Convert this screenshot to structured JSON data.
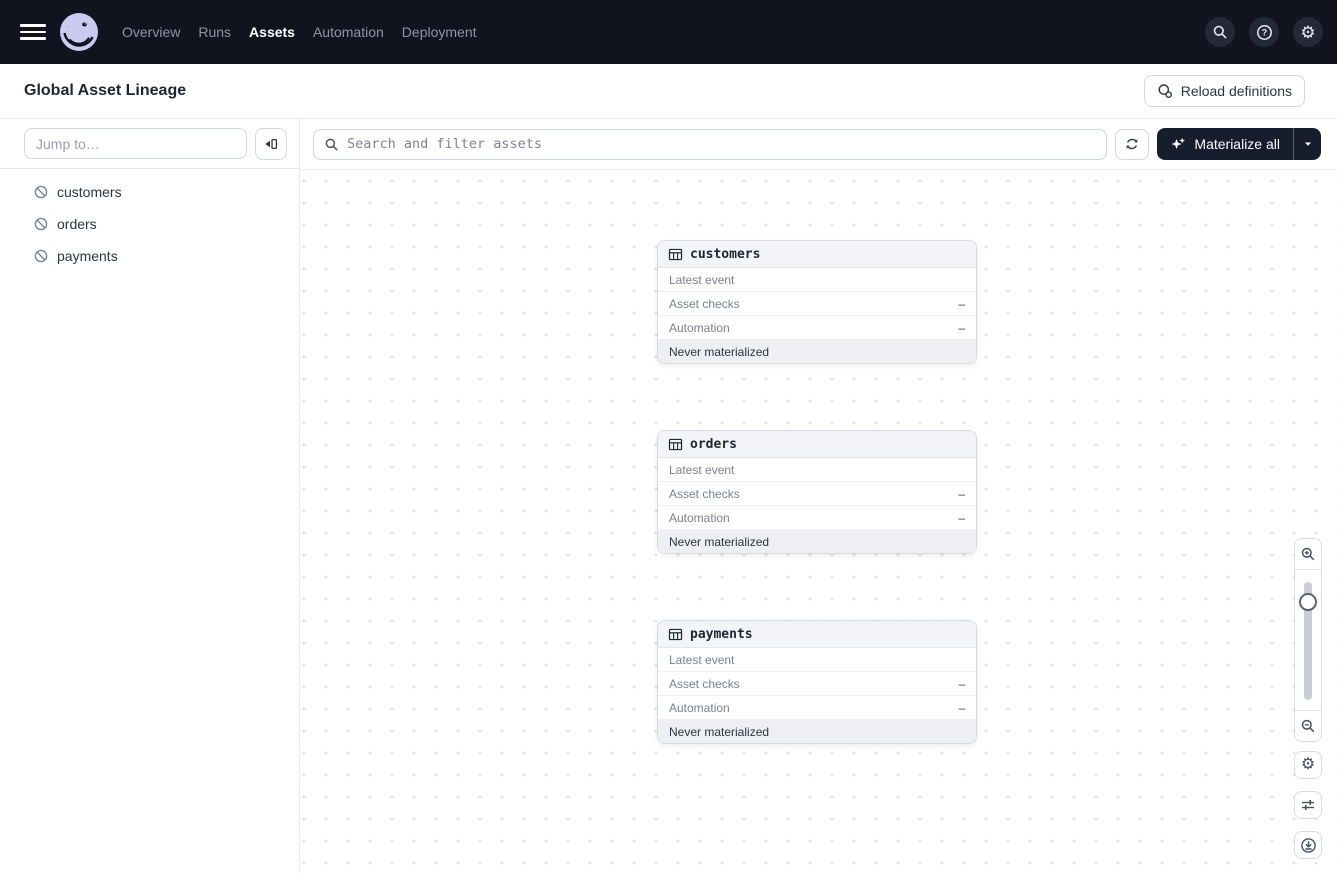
{
  "nav": {
    "items": [
      {
        "label": "Overview",
        "active": false
      },
      {
        "label": "Runs",
        "active": false
      },
      {
        "label": "Assets",
        "active": true
      },
      {
        "label": "Automation",
        "active": false
      },
      {
        "label": "Deployment",
        "active": false
      }
    ],
    "right_icons": [
      "search-icon",
      "help-icon",
      "gear-icon"
    ]
  },
  "header": {
    "title": "Global Asset Lineage",
    "reload_button_label": "Reload definitions"
  },
  "sidebar": {
    "jump_placeholder": "Jump to…",
    "assets": [
      {
        "name": "customers"
      },
      {
        "name": "orders"
      },
      {
        "name": "payments"
      }
    ]
  },
  "toolbar": {
    "search_placeholder": "Search and filter assets",
    "materialize_label": "Materialize all"
  },
  "graph": {
    "nodes": [
      {
        "name": "customers",
        "rows": [
          {
            "label": "Latest event",
            "value": ""
          },
          {
            "label": "Asset checks",
            "value": "–"
          },
          {
            "label": "Automation",
            "value": "–"
          }
        ],
        "status": "Never materialized"
      },
      {
        "name": "orders",
        "rows": [
          {
            "label": "Latest event",
            "value": ""
          },
          {
            "label": "Asset checks",
            "value": "–"
          },
          {
            "label": "Automation",
            "value": "–"
          }
        ],
        "status": "Never materialized"
      },
      {
        "name": "payments",
        "rows": [
          {
            "label": "Latest event",
            "value": ""
          },
          {
            "label": "Asset checks",
            "value": "–"
          },
          {
            "label": "Automation",
            "value": "–"
          }
        ],
        "status": "Never materialized"
      }
    ]
  },
  "colors": {
    "navbar_bg": "#11141f",
    "logo_lavender": "#cdcaf1",
    "primary_button_bg": "#161d2c",
    "node_header_bg": "#f3f4f7",
    "node_footer_bg": "#edeff3"
  }
}
